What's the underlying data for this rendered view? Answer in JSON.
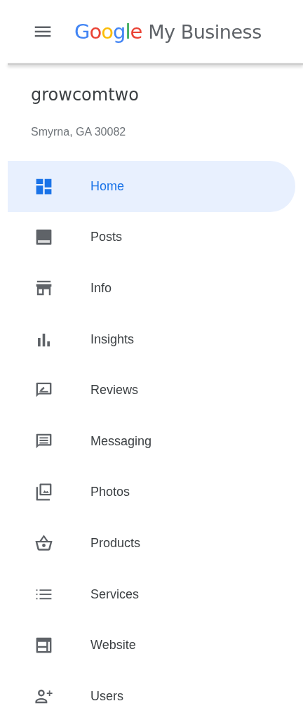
{
  "header": {
    "brand": "Google",
    "product": "My Business"
  },
  "business": {
    "name": "growcomtwo",
    "address": "Smyrna, GA 30082"
  },
  "nav_items": [
    {
      "label": "Home",
      "selected": true
    },
    {
      "label": "Posts",
      "selected": false
    },
    {
      "label": "Info",
      "selected": false
    },
    {
      "label": "Insights",
      "selected": false
    },
    {
      "label": "Reviews",
      "selected": false
    },
    {
      "label": "Messaging",
      "selected": false
    },
    {
      "label": "Photos",
      "selected": false
    },
    {
      "label": "Products",
      "selected": false
    },
    {
      "label": "Services",
      "selected": false
    },
    {
      "label": "Website",
      "selected": false
    },
    {
      "label": "Users",
      "selected": false
    }
  ]
}
